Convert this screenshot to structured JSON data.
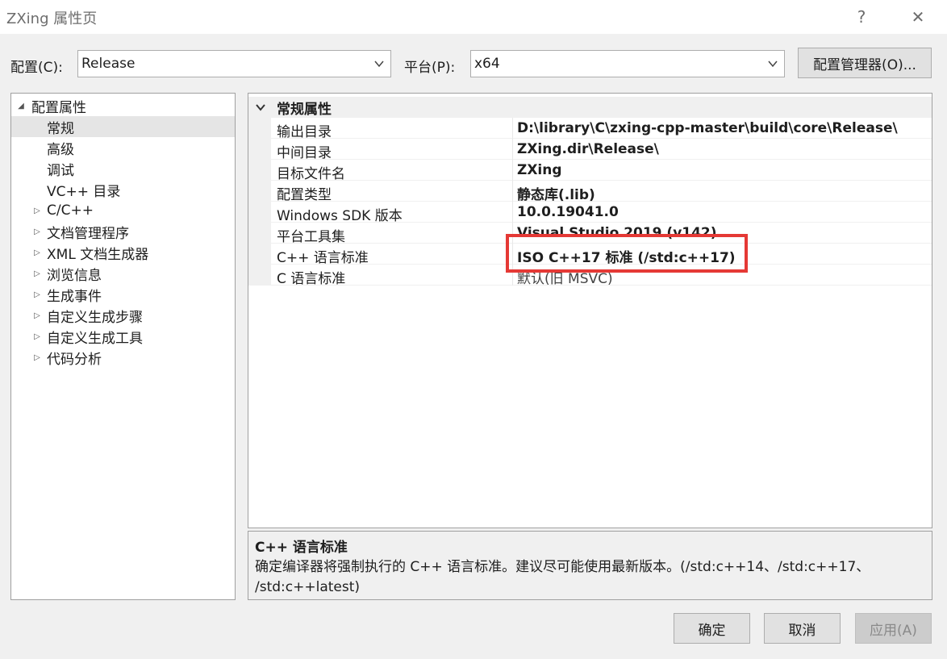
{
  "window": {
    "title": "ZXing 属性页",
    "help": "?",
    "close": "✕"
  },
  "toolbar": {
    "config_label": "配置(C):",
    "config_value": "Release",
    "platform_label": "平台(P):",
    "platform_value": "x64",
    "config_manager": "配置管理器(O)..."
  },
  "tree": {
    "root": "配置属性",
    "items": [
      {
        "label": "常规",
        "selected": true,
        "expandable": false
      },
      {
        "label": "高级",
        "selected": false,
        "expandable": false
      },
      {
        "label": "调试",
        "selected": false,
        "expandable": false
      },
      {
        "label": "VC++ 目录",
        "selected": false,
        "expandable": false
      },
      {
        "label": "C/C++",
        "selected": false,
        "expandable": true
      },
      {
        "label": "文档管理程序",
        "selected": false,
        "expandable": true
      },
      {
        "label": "XML 文档生成器",
        "selected": false,
        "expandable": true
      },
      {
        "label": "浏览信息",
        "selected": false,
        "expandable": true
      },
      {
        "label": "生成事件",
        "selected": false,
        "expandable": true
      },
      {
        "label": "自定义生成步骤",
        "selected": false,
        "expandable": true
      },
      {
        "label": "自定义生成工具",
        "selected": false,
        "expandable": true
      },
      {
        "label": "代码分析",
        "selected": false,
        "expandable": true
      }
    ]
  },
  "grid": {
    "category": "常规属性",
    "rows": [
      {
        "name": "输出目录",
        "value": "D:\\library\\C\\zxing-cpp-master\\build\\core\\Release\\"
      },
      {
        "name": "中间目录",
        "value": "ZXing.dir\\Release\\"
      },
      {
        "name": "目标文件名",
        "value": "ZXing"
      },
      {
        "name": "配置类型",
        "value": "静态库(.lib)"
      },
      {
        "name": "Windows SDK 版本",
        "value": "10.0.19041.0"
      },
      {
        "name": "平台工具集",
        "value": "Visual Studio 2019 (v142)"
      },
      {
        "name": "C++ 语言标准",
        "value": "ISO C++17 标准 (/std:c++17)"
      },
      {
        "name": "C 语言标准",
        "value": "默认(旧 MSVC)"
      }
    ]
  },
  "description": {
    "title": "C++ 语言标准",
    "line1": "确定编译器将强制执行的 C++ 语言标准。建议尽可能使用最新版本。(/std:c++14、/std:c++17、",
    "line2": "/std:c++latest)"
  },
  "buttons": {
    "ok": "确定",
    "cancel": "取消",
    "apply": "应用(A)"
  },
  "colors": {
    "highlight_box": "#e53935",
    "selected_row": "#e5e5e5"
  }
}
